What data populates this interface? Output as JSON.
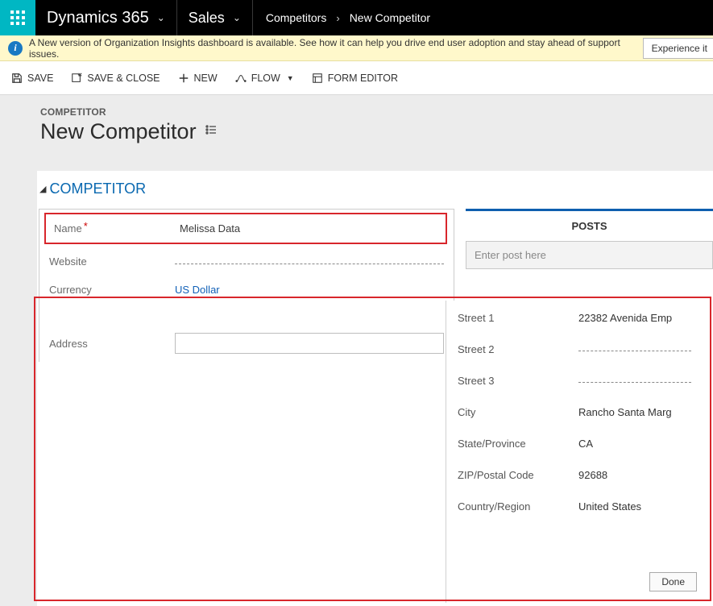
{
  "nav": {
    "brand": "Dynamics 365",
    "area": "Sales",
    "crumb1": "Competitors",
    "crumb2": "New Competitor"
  },
  "notice": {
    "text": "A New version of Organization Insights dashboard is available. See how it can help you drive end user adoption and stay ahead of support issues.",
    "button": "Experience it"
  },
  "commands": {
    "save": "SAVE",
    "save_close": "SAVE & CLOSE",
    "new": "NEW",
    "flow": "FLOW",
    "form_editor": "FORM EDITOR"
  },
  "page": {
    "entity": "COMPETITOR",
    "title": "New Competitor",
    "section": "COMPETITOR"
  },
  "fields": {
    "name_label": "Name",
    "name_value": "Melissa Data",
    "website_label": "Website",
    "currency_label": "Currency",
    "currency_value": "US Dollar",
    "address_label": "Address"
  },
  "right": {
    "posts_tab": "POSTS",
    "post_placeholder": "Enter post here"
  },
  "flyout": {
    "street1_label": "Street 1",
    "street1_value": "22382 Avenida Emp",
    "street2_label": "Street 2",
    "street3_label": "Street 3",
    "city_label": "City",
    "city_value": "Rancho Santa Marg",
    "state_label": "State/Province",
    "state_value": "CA",
    "zip_label": "ZIP/Postal Code",
    "zip_value": "92688",
    "country_label": "Country/Region",
    "country_value": "United States",
    "done": "Done"
  }
}
